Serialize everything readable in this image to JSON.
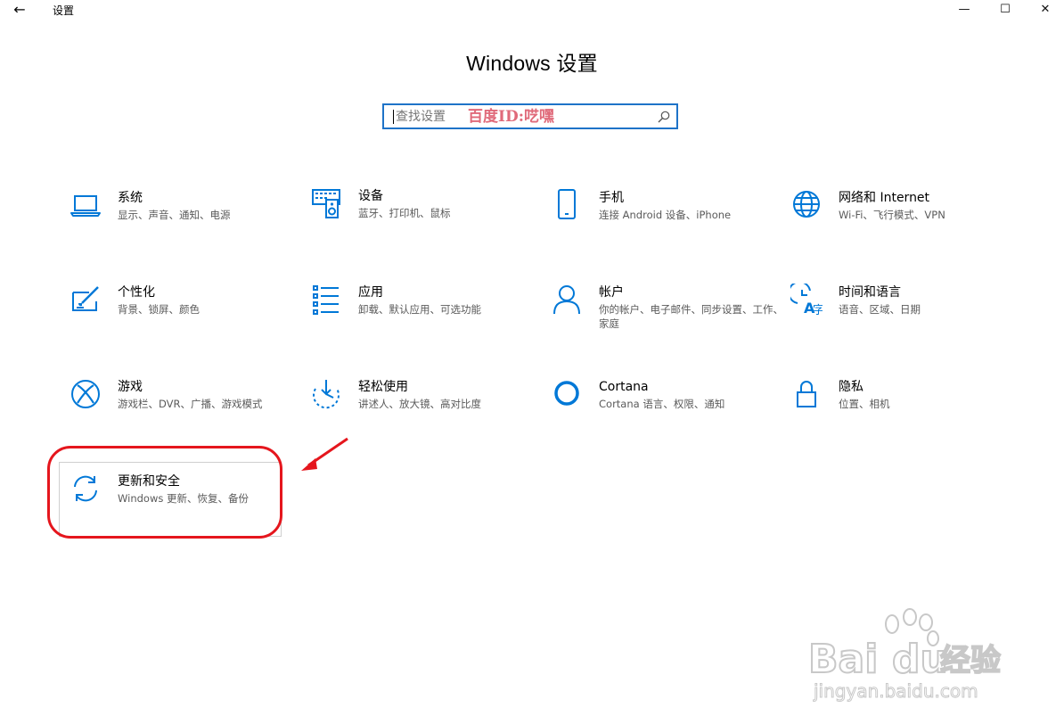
{
  "window": {
    "title": "设置",
    "back_glyph": "←",
    "minimize_glyph": "—",
    "maximize_glyph": "☐",
    "close_glyph": "✕"
  },
  "heading": "Windows 设置",
  "search": {
    "placeholder": "查找设置",
    "watermark": "百度ID:呓嘿"
  },
  "accent_color": "#0078d7",
  "tiles": [
    {
      "icon": "laptop-icon",
      "title": "系统",
      "desc": "显示、声音、通知、电源"
    },
    {
      "icon": "keyboard-speaker-icon",
      "title": "设备",
      "desc": "蓝牙、打印机、鼠标"
    },
    {
      "icon": "phone-icon",
      "title": "手机",
      "desc": "连接 Android 设备、iPhone"
    },
    {
      "icon": "globe-icon",
      "title": "网络和 Internet",
      "desc": "Wi-Fi、飞行模式、VPN"
    },
    {
      "icon": "paint-brush-icon",
      "title": "个性化",
      "desc": "背景、锁屏、颜色"
    },
    {
      "icon": "apps-list-icon",
      "title": "应用",
      "desc": "卸载、默认应用、可选功能"
    },
    {
      "icon": "person-icon",
      "title": "帐户",
      "desc": "你的帐户、电子邮件、同步设置、工作、家庭"
    },
    {
      "icon": "time-language-icon",
      "title": "时间和语言",
      "desc": "语音、区域、日期"
    },
    {
      "icon": "xbox-icon",
      "title": "游戏",
      "desc": "游戏栏、DVR、广播、游戏模式"
    },
    {
      "icon": "ease-of-access-icon",
      "title": "轻松使用",
      "desc": "讲述人、放大镜、高对比度"
    },
    {
      "icon": "cortana-icon",
      "title": "Cortana",
      "desc": "Cortana 语言、权限、通知"
    },
    {
      "icon": "lock-icon",
      "title": "隐私",
      "desc": "位置、相机"
    },
    {
      "icon": "sync-arrows-icon",
      "title": "更新和安全",
      "desc": "Windows 更新、恢复、备份"
    }
  ],
  "baidu_watermark": {
    "brand_latin_1": "Bai",
    "brand_latin_2": "du",
    "brand_cn": "经验",
    "url": "jingyan.baidu.com"
  }
}
